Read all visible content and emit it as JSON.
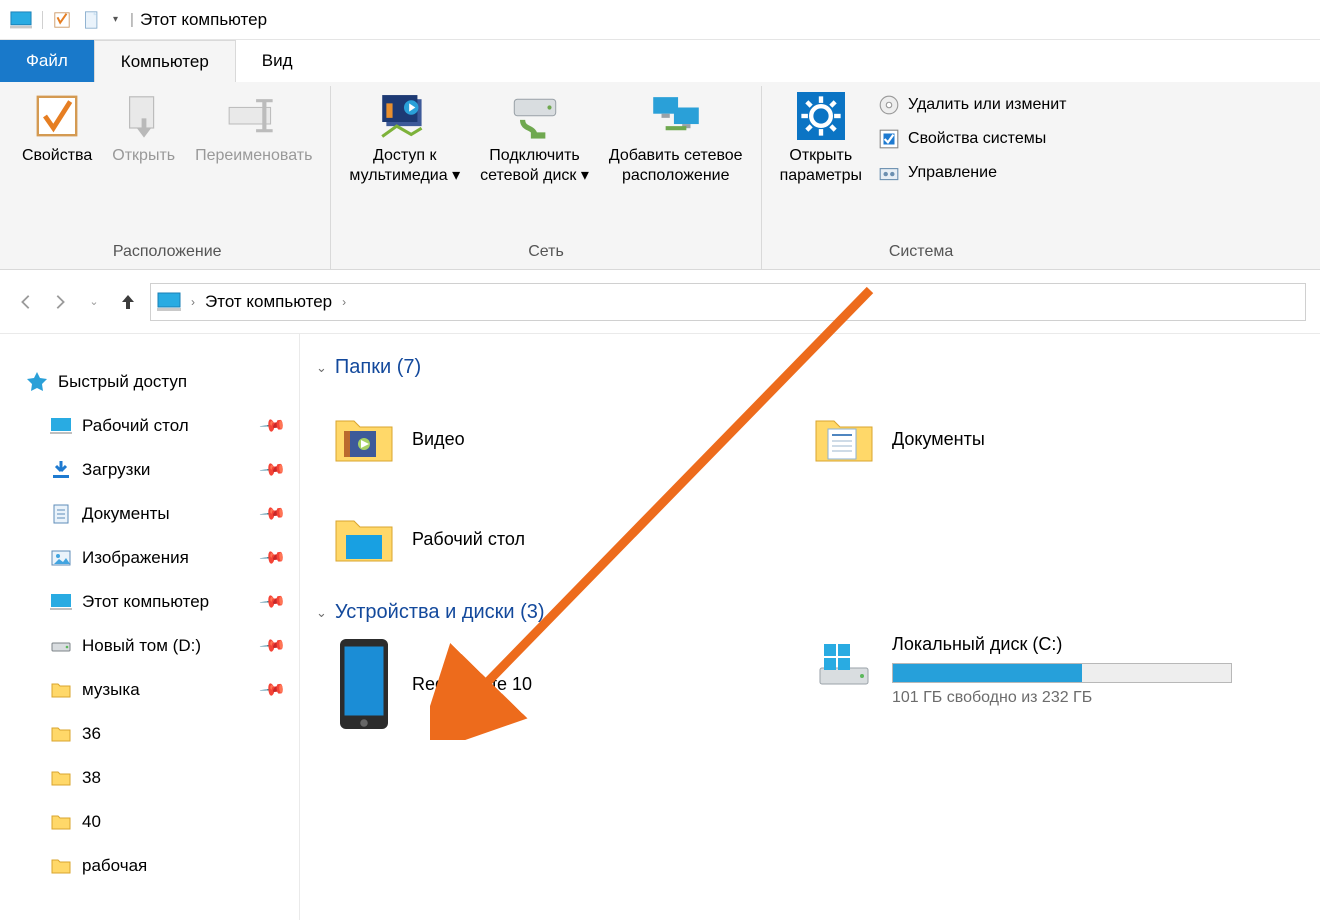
{
  "titlebar": {
    "title": "Этот компьютер"
  },
  "tabs": {
    "file": "Файл",
    "computer": "Компьютер",
    "view": "Вид"
  },
  "ribbon": {
    "loc": {
      "properties": "Свойства",
      "open": "Открыть",
      "rename": "Переименовать",
      "group": "Расположение"
    },
    "net": {
      "media": "Доступ к\nмультимедиа ▾",
      "map": "Подключить\nсетевой диск ▾",
      "addnet": "Добавить сетевое\nрасположение",
      "group": "Сеть"
    },
    "sys": {
      "settings": "Открыть\nпараметры",
      "uninstall": "Удалить или изменит",
      "sysprops": "Свойства системы",
      "manage": "Управление",
      "group": "Система"
    }
  },
  "breadcrumb": {
    "root": "Этот компьютер"
  },
  "sidebar": {
    "quick": "Быстрый доступ",
    "items": [
      {
        "label": "Рабочий стол",
        "pinned": true
      },
      {
        "label": "Загрузки",
        "pinned": true
      },
      {
        "label": "Документы",
        "pinned": true
      },
      {
        "label": "Изображения",
        "pinned": true
      },
      {
        "label": "Этот компьютер",
        "pinned": true
      },
      {
        "label": "Новый том (D:)",
        "pinned": true
      },
      {
        "label": "музыка",
        "pinned": true
      },
      {
        "label": "36",
        "pinned": false
      },
      {
        "label": "38",
        "pinned": false
      },
      {
        "label": "40",
        "pinned": false
      },
      {
        "label": "рабочая",
        "pinned": false
      }
    ]
  },
  "main": {
    "folders_header": "Папки (7)",
    "folders": [
      {
        "label": "Видео"
      },
      {
        "label": "Документы"
      },
      {
        "label": "Рабочий стол"
      }
    ],
    "devices_header": "Устройства и диски (3)",
    "device_phone": "Redmi Note 10",
    "drive_c": {
      "label": "Локальный диск (C:)",
      "sub": "101 ГБ свободно из 232 ГБ",
      "fill_pct": 56
    }
  }
}
